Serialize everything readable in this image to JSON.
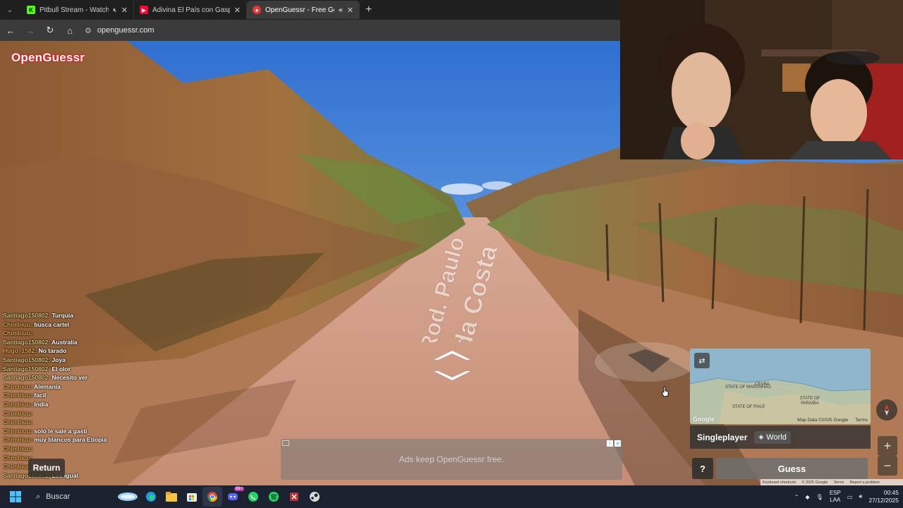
{
  "browser": {
    "tabs": [
      {
        "title": "Pitbull Stream - Watch Live",
        "favicon": "kick-icon",
        "favicon_color": "#53fc18",
        "active": false,
        "muted": true
      },
      {
        "title": "Adivina El País con Gaspi - You",
        "favicon": "youtube-icon",
        "favicon_color": "#ff0033",
        "active": false,
        "muted": false
      },
      {
        "title": "OpenGuessr - Free GeoGue",
        "favicon": "openguessr-icon",
        "favicon_color": "#e53935",
        "active": true,
        "muted": false,
        "audio": true
      }
    ],
    "url": "openguessr.com"
  },
  "game": {
    "logo": "OpenGuessr",
    "road_label": [
      "Rod. Paulo",
      "da Costa"
    ],
    "mode": "Singleplayer",
    "map": "World",
    "help_label": "?",
    "guess_label": "Guess",
    "return_label": "Return",
    "ad_text": "Ads keep OpenGuessr free."
  },
  "minimap": {
    "labels": [
      "STATE OF MARANHÃO",
      "CEARA",
      "STATE OF PIAUÍ",
      "STATE OF PARAÍBA"
    ],
    "attribution": "Map Data ©2025 Google",
    "terms": "Terms",
    "google": "Google"
  },
  "google_footer": [
    "Keyboard shortcuts",
    "© 2025 Google",
    "Terms",
    "Report a problem"
  ],
  "chat": [
    {
      "user": "Santiago150802:",
      "msg": "Turquia",
      "style": ""
    },
    {
      "user": "Chimbiuu:",
      "msg": "busca cartel",
      "style": "alt"
    },
    {
      "user": "Chimbiuu:",
      "msg": "",
      "style": "alt"
    },
    {
      "user": "Santiago150802:",
      "msg": "Australia",
      "style": ""
    },
    {
      "user": "Hugo_1582:",
      "msg": "No tarado",
      "style": "alt"
    },
    {
      "user": "Santiago150802:",
      "msg": "Joya",
      "style": ""
    },
    {
      "user": "Santiago150802:",
      "msg": "El olor",
      "style": ""
    },
    {
      "user": "Santiago150802:",
      "msg": "Necesito ver",
      "style": ""
    },
    {
      "user": "Chimbiuu:",
      "msg": "Alemania",
      "style": "alt"
    },
    {
      "user": "Chimbiuu:",
      "msg": "facil",
      "style": "alt"
    },
    {
      "user": "Chimbiuu:",
      "msg": "India",
      "style": "alt"
    },
    {
      "user": "Chimbiuu:",
      "msg": "",
      "style": "alt"
    },
    {
      "user": "",
      "msg": "",
      "style": "blue"
    },
    {
      "user": "Chimbiuu:",
      "msg": "",
      "style": "alt"
    },
    {
      "user": "Chimbiuu:",
      "msg": "solo le sale a gasti",
      "style": "alt"
    },
    {
      "user": "Chimbiuu:",
      "msg": "muy blancos para Etiopia",
      "style": "alt"
    },
    {
      "user": "Chimbiuu:",
      "msg": "",
      "style": "alt"
    },
    {
      "user": "Chimbiuu:",
      "msg": "",
      "style": "alt"
    },
    {
      "user": "Chimbiuu:",
      "msg": "",
      "style": "alt"
    },
    {
      "user": "Santiago150802:",
      "msg": "Los igual",
      "style": ""
    }
  ],
  "taskbar": {
    "search_placeholder": "Buscar",
    "discord_badge": "99+",
    "language": [
      "ESP",
      "LAA"
    ],
    "time": "00:45",
    "date": "27/12/2025"
  },
  "colors": {
    "accent": "#e53935",
    "sky": "#3f86e0",
    "dirt": "#c98f6e"
  }
}
